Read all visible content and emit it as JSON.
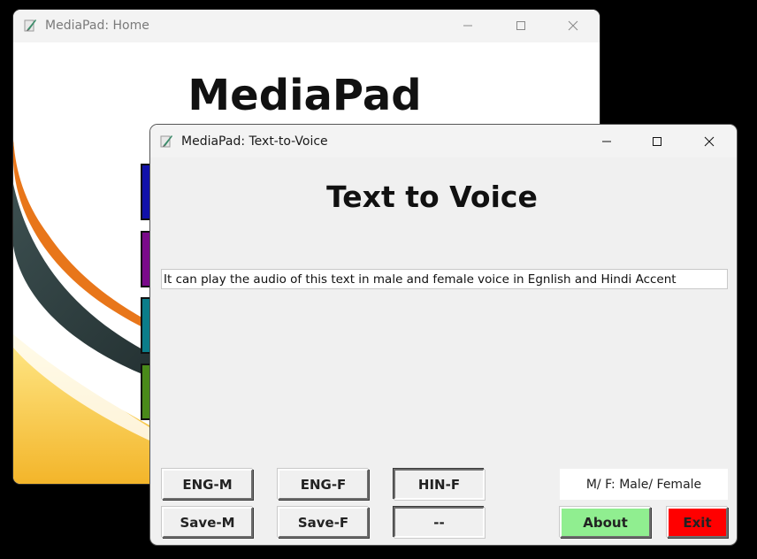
{
  "back_window": {
    "title": "MediaPad: Home",
    "heading": "MediaPad",
    "button_colors": [
      "#1111aa",
      "#7a0a8a",
      "#0b7d8a",
      "#4a8a1a"
    ]
  },
  "front_window": {
    "title": "MediaPad: Text-to-Voice",
    "heading": "Text to Voice",
    "input_value": "It can play the audio of this text in male and female voice in Egnlish and Hindi Accent",
    "buttons": {
      "eng_m": "ENG-M",
      "eng_f": "ENG-F",
      "hin_f": "HIN-F",
      "save_m": "Save-M",
      "save_f": "Save-F",
      "blank": "--",
      "about": "About",
      "exit": "Exit"
    },
    "legend": "M/ F: Male/ Female",
    "colors": {
      "about_bg": "#90ee90",
      "exit_bg": "#ff0000"
    }
  },
  "icons": {
    "app": "feather-pen-icon",
    "minimize": "minimize-icon",
    "maximize": "maximize-icon",
    "close": "close-icon"
  }
}
